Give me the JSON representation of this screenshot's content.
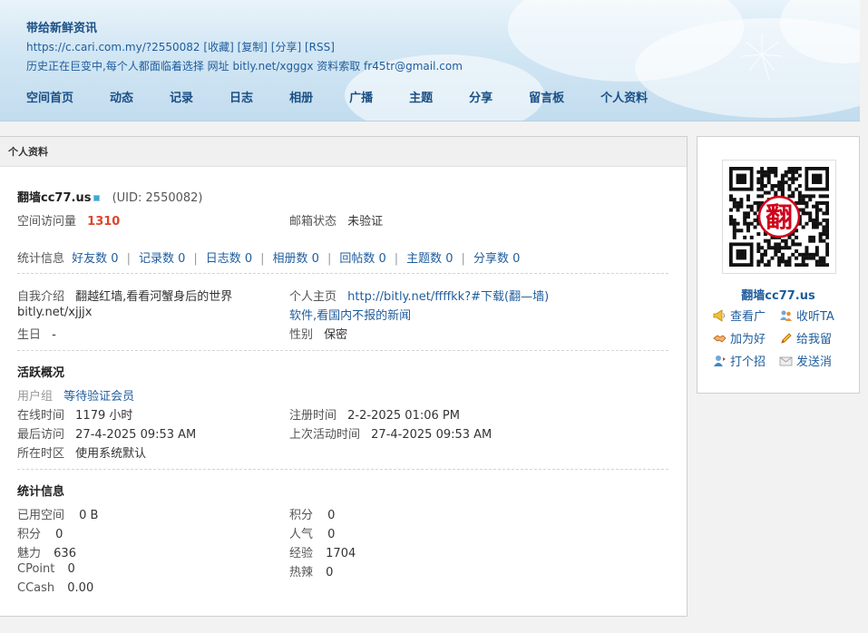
{
  "header": {
    "title": "带给新鲜资讯",
    "url": "https://c.cari.com.my/?2550082",
    "links": [
      "[收藏]",
      "[复制]",
      "[分享]",
      "[RSS]"
    ],
    "description": "历史正在巨变中,每个人都面临着选择 网址 bitly.net/xgggx 资料索取 fr45tr@gmail.com"
  },
  "nav": [
    "空间首页",
    "动态",
    "记录",
    "日志",
    "相册",
    "广播",
    "主题",
    "分享",
    "留言板",
    "个人资料"
  ],
  "panel": {
    "title": "个人资料",
    "username": "翻墙cc77.us",
    "uid": "(UID: 2550082)",
    "visits_label": "空间访问量",
    "visits_value": "1310",
    "email_label": "邮箱状态",
    "email_value": "未验证",
    "stats_label": "统计信息",
    "stats": [
      "好友数 0",
      "记录数 0",
      "日志数 0",
      "相册数 0",
      "回帖数 0",
      "主题数 0",
      "分享数 0"
    ],
    "intro_label": "自我介绍",
    "intro_value": "翻越红墙,看看河蟹身后的世界",
    "intro_value2": "bitly.net/xjjjx",
    "homepage_label": "个人主页",
    "homepage_value": "http://bitly.net/ffffkk?#下载(翻—墙)",
    "homepage_value2": "软件,看国内不报的新闻",
    "birthday_label": "生日",
    "birthday_value": "-",
    "gender_label": "性别",
    "gender_value": "保密",
    "activity_title": "活跃概况",
    "group_label": "用户组",
    "group_value": "等待验证会员",
    "online_label": "在线时间",
    "online_value": "1179 小时",
    "reg_label": "注册时间",
    "reg_value": "2-2-2025 01:06 PM",
    "last_visit_label": "最后访问",
    "last_visit_value": "27-4-2025 09:53 AM",
    "last_active_label": "上次活动时间",
    "last_active_value": "27-4-2025 09:53 AM",
    "region_label": "所在时区",
    "region_value": "使用系统默认",
    "stats_title": "统计信息",
    "used_space_label": "已用空间",
    "used_space_value": "0 B",
    "points_label": "积分",
    "points_value": "0",
    "points2_label": "积分",
    "points2_value": "0",
    "popularity_label": "人气",
    "popularity_value": "0",
    "charm_label": "魅力",
    "charm_value": "636",
    "exp_label": "经验",
    "exp_value": "1704",
    "cpoint_label": "CPoint",
    "cpoint_value": "0",
    "hot_label": "热辣",
    "hot_value": "0",
    "ccash_label": "CCash",
    "ccash_value": "0.00"
  },
  "side": {
    "qr_center_text": "翻",
    "name": "翻墙cc77.us",
    "actions": [
      {
        "icon": "megaphone-icon",
        "label": "查看广"
      },
      {
        "icon": "users-listen-icon",
        "label": "收听TA"
      },
      {
        "icon": "handshake-icon",
        "label": "加为好"
      },
      {
        "icon": "pencil-icon",
        "label": "给我留"
      },
      {
        "icon": "user-poke-icon",
        "label": "打个招"
      },
      {
        "icon": "envelope-icon",
        "label": "发送消"
      }
    ]
  },
  "colors": {
    "link": "#1f5d9c",
    "visits": "#e0442b",
    "header_bg": "#d3e7f4"
  }
}
